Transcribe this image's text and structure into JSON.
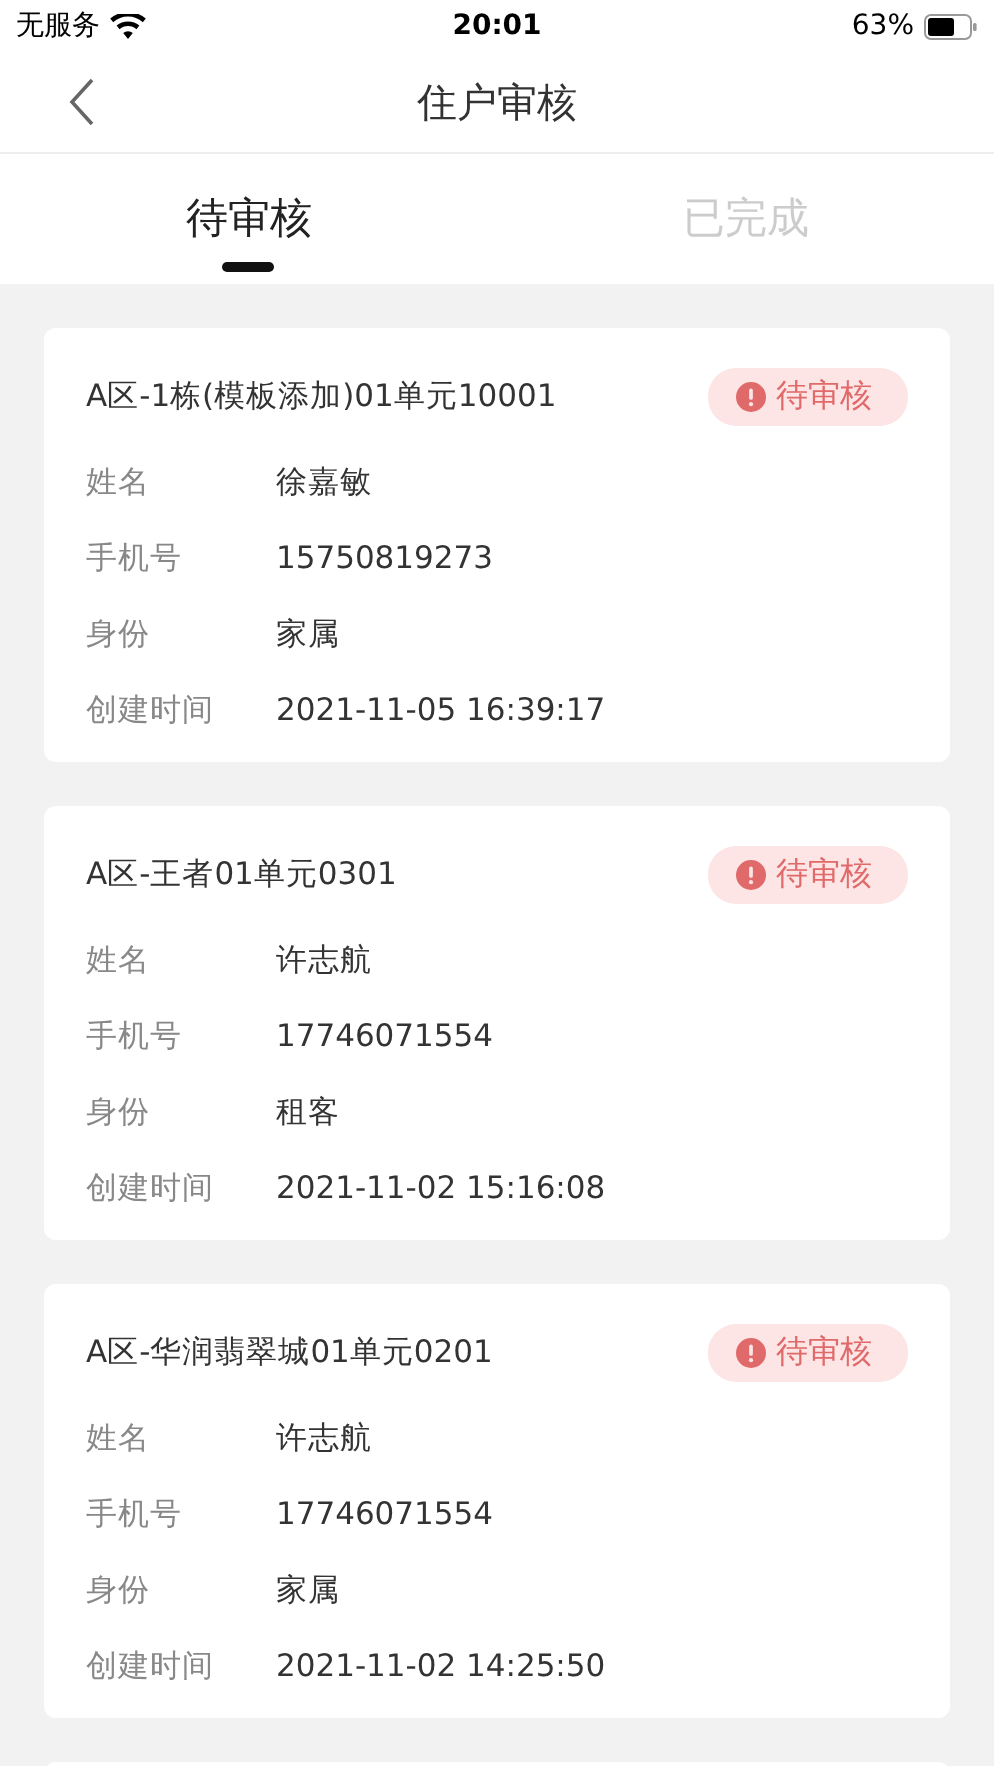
{
  "status_bar": {
    "carrier": "无服务",
    "time": "20:01",
    "battery": "63%"
  },
  "nav": {
    "title": "住户审核"
  },
  "tabs": [
    {
      "label": "待审核",
      "selected": true
    },
    {
      "label": "已完成",
      "selected": false
    }
  ],
  "records": [
    {
      "address": "A区-1栋(模板添加)01单元10001",
      "status": {
        "kind": "pending",
        "label": "待审核"
      },
      "fields": [
        {
          "label": "姓名",
          "value": "徐嘉敏"
        },
        {
          "label": "手机号",
          "value": "15750819273"
        },
        {
          "label": "身份",
          "value": "家属"
        },
        {
          "label": "创建时间",
          "value": "2021-11-05 16:39:17"
        }
      ]
    },
    {
      "address": "A区-王者01单元0301",
      "status": {
        "kind": "pending",
        "label": "待审核"
      },
      "fields": [
        {
          "label": "姓名",
          "value": "许志航"
        },
        {
          "label": "手机号",
          "value": "17746071554"
        },
        {
          "label": "身份",
          "value": "租客"
        },
        {
          "label": "创建时间",
          "value": "2021-11-02 15:16:08"
        }
      ]
    },
    {
      "address": "A区-华润翡翠城01单元0201",
      "status": {
        "kind": "pending",
        "label": "待审核"
      },
      "fields": [
        {
          "label": "姓名",
          "value": "许志航"
        },
        {
          "label": "手机号",
          "value": "17746071554"
        },
        {
          "label": "身份",
          "value": "家属"
        },
        {
          "label": "创建时间",
          "value": "2021-11-02 14:25:50"
        }
      ]
    }
  ]
}
